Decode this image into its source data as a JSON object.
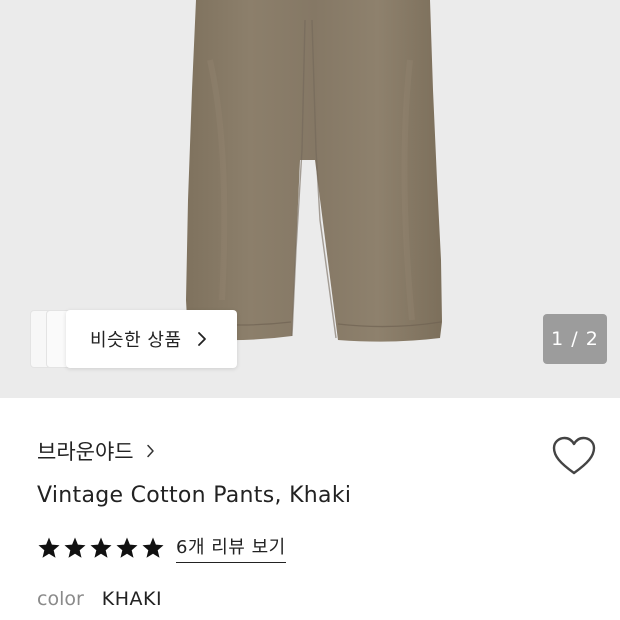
{
  "gallery": {
    "similar_products_label": "비슷한 상품",
    "page_indicator": "1 / 2"
  },
  "product": {
    "brand": "브라운야드",
    "name": "Vintage Cotton Pants, Khaki",
    "rating_stars": 5,
    "review_link": "6개 리뷰 보기",
    "option_label": "color",
    "option_value": "KHAKI"
  },
  "colors": {
    "hero_background": "#ebebeb",
    "pants_khaki": "#8a7c68",
    "page_indicator_bg": "#9c9c9c",
    "star": "#111111"
  },
  "icons": [
    "chevron-right-icon",
    "heart-outline-icon",
    "star-filled-icon"
  ]
}
